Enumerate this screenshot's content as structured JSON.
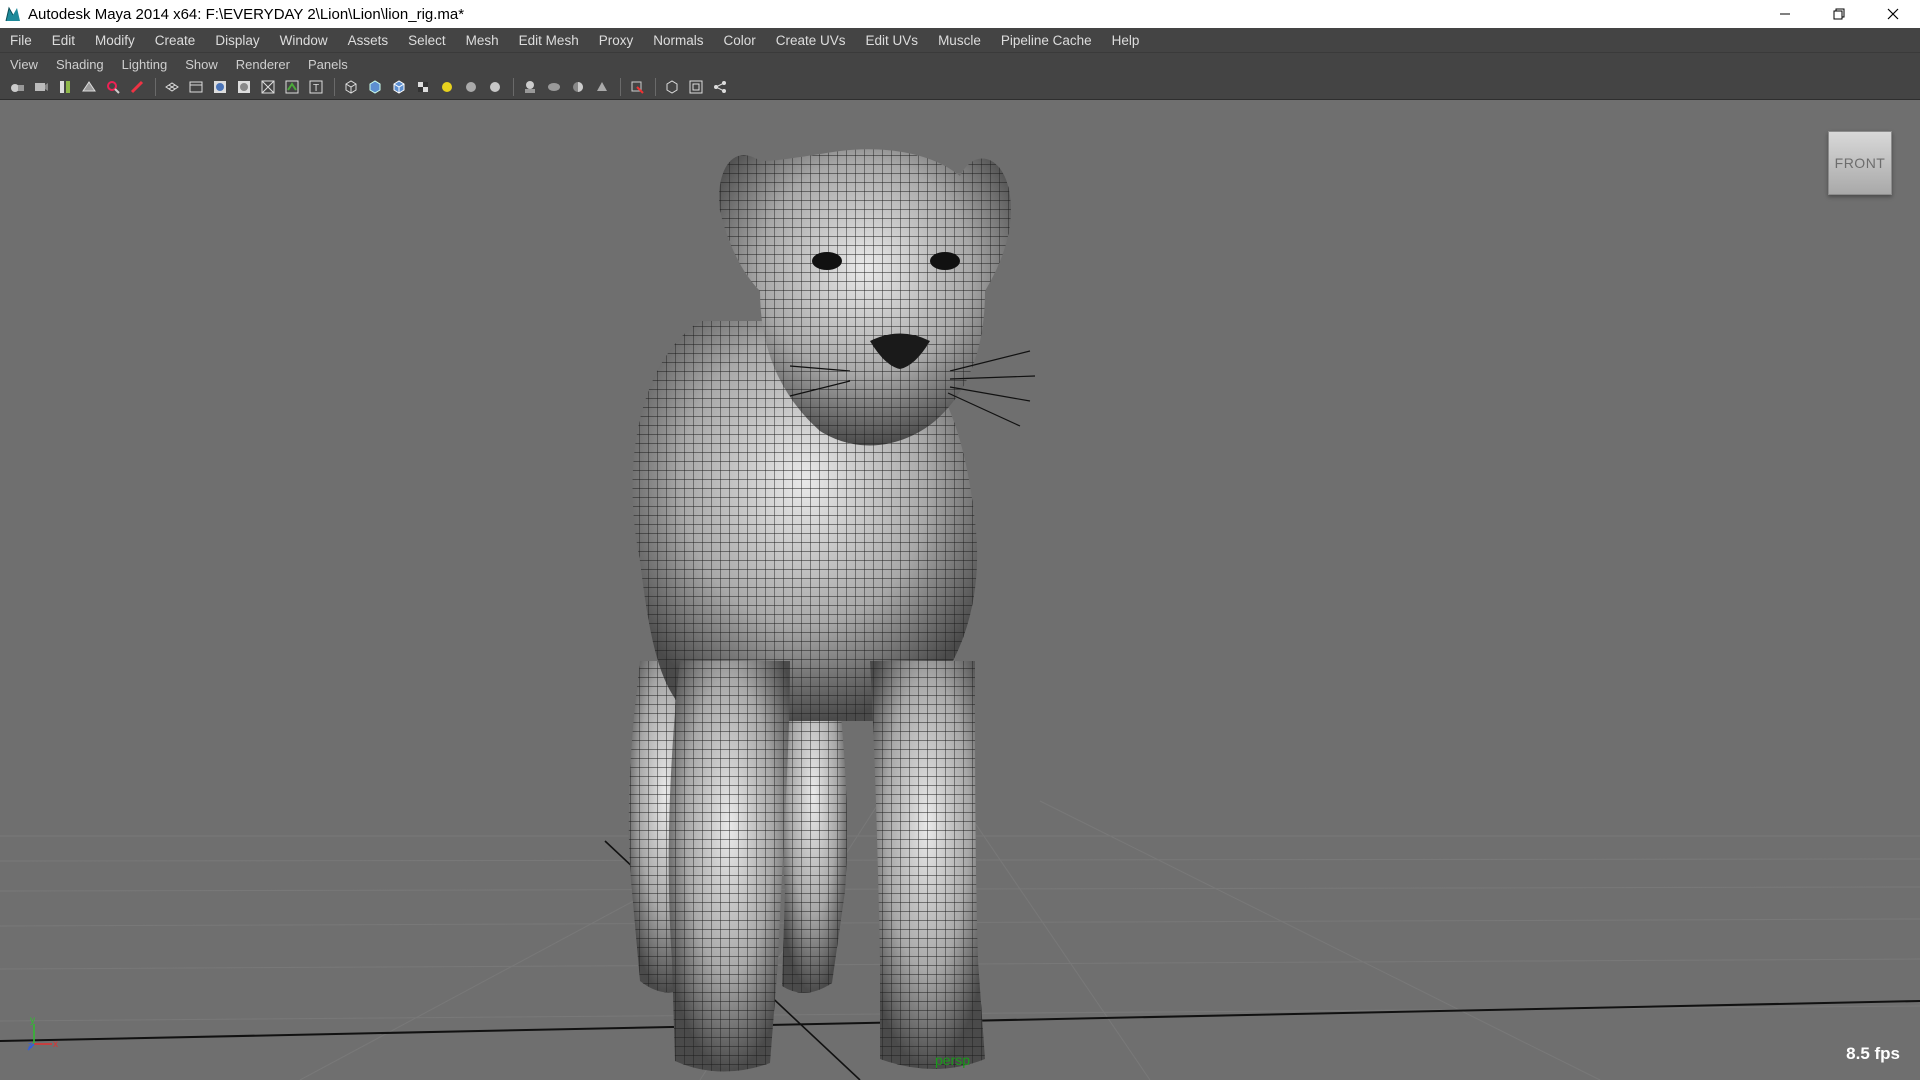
{
  "window": {
    "title": "Autodesk Maya 2014 x64: F:\\EVERYDAY 2\\Lion\\Lion\\lion_rig.ma*"
  },
  "main_menu": [
    "File",
    "Edit",
    "Modify",
    "Create",
    "Display",
    "Window",
    "Assets",
    "Select",
    "Mesh",
    "Edit Mesh",
    "Proxy",
    "Normals",
    "Color",
    "Create UVs",
    "Edit UVs",
    "Muscle",
    "Pipeline Cache",
    "Help"
  ],
  "panel_menu": [
    "View",
    "Shading",
    "Lighting",
    "Show",
    "Renderer",
    "Panels"
  ],
  "viewport": {
    "view_cube_label": "FRONT",
    "fps": "8.5 fps",
    "camera": "persp",
    "axis_labels": {
      "y": "y",
      "z": "z",
      "x": "x"
    }
  },
  "colors": {
    "viewport_bg": "#6f6f6f",
    "ui_panel": "#444444",
    "camera_label": "#1a9b1a"
  }
}
